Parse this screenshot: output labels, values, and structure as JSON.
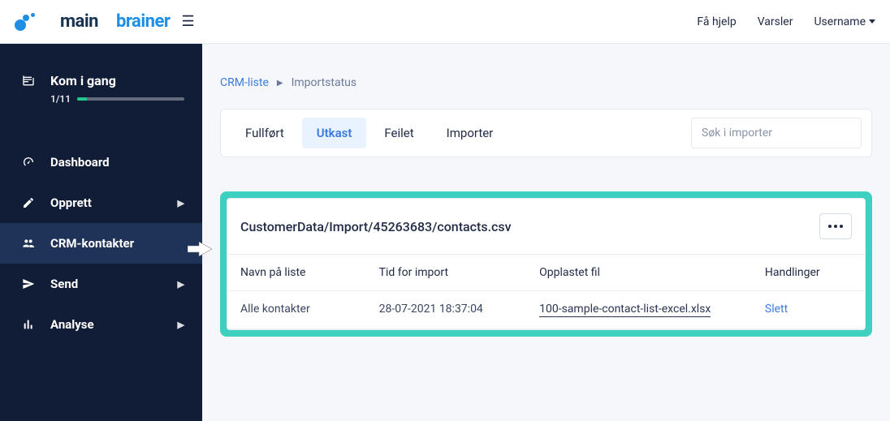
{
  "logo": {
    "main": "main",
    "brainer": "brainer"
  },
  "topbar": {
    "help": "Få hjelp",
    "alerts": "Varsler",
    "username": "Username"
  },
  "sidebar": {
    "getStarted": {
      "title": "Kom i gang",
      "count": "1/11"
    },
    "items": [
      {
        "label": "Dashboard"
      },
      {
        "label": "Opprett"
      },
      {
        "label": "CRM-kontakter"
      },
      {
        "label": "Send"
      },
      {
        "label": "Analyse"
      }
    ]
  },
  "breadcrumb": {
    "root": "CRM-liste",
    "current": "Importstatus"
  },
  "tabs": {
    "completed": "Fullført",
    "draft": "Utkast",
    "failed": "Feilet",
    "import": "Importer"
  },
  "search": {
    "placeholder": "Søk i importer"
  },
  "importCard": {
    "title": "CustomerData/Import/45263683/contacts.csv",
    "columns": {
      "listName": "Navn på liste",
      "importTime": "Tid for import",
      "uploadedFile": "Opplastet fil",
      "actions": "Handlinger"
    },
    "row": {
      "listName": "Alle kontakter",
      "importTime": "28-07-2021 18:37:04",
      "uploadedFile": "100-sample-contact-list-excel.xlsx",
      "action": "Slett"
    }
  }
}
